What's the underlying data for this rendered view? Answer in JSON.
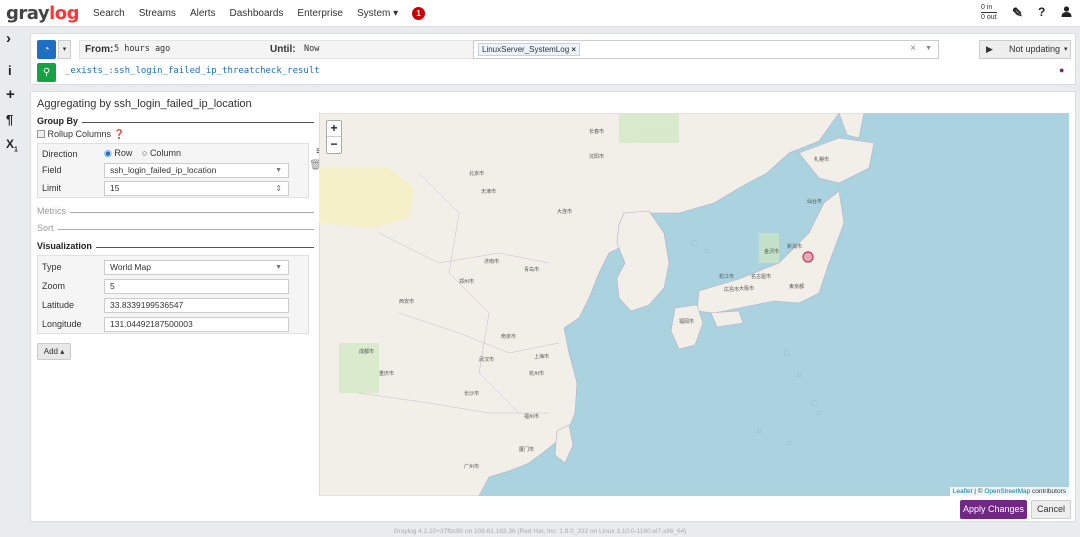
{
  "nav": {
    "logo_a": "gray",
    "logo_b": "log",
    "items": [
      "Search",
      "Streams",
      "Alerts",
      "Dashboards",
      "Enterprise",
      "System ▾"
    ],
    "notification_count": "1",
    "throughput_in": "0 in",
    "throughput_out": "0 out"
  },
  "query": {
    "from_label": "From:",
    "from_value": "5 hours ago",
    "until_label": "Until:",
    "until_value": "Now",
    "stream_chip": "LinuxServer_SystemLog",
    "update_label": "Not updating",
    "text": "_exists_:ssh_login_failed_ip_threatcheck_result"
  },
  "widget": {
    "title": "Aggregating by ssh_login_failed_ip_location",
    "group_by_label": "Group By",
    "rollup_label": "Rollup Columns",
    "direction_label": "Direction",
    "row_label": "Row",
    "column_label": "Column",
    "field_label": "Field",
    "field_value": "ssh_login_failed_ip_location",
    "limit_label": "Limit",
    "limit_value": "15",
    "metrics_label": "Metrics",
    "sort_label": "Sort",
    "visualization_label": "Visualization",
    "type_label": "Type",
    "type_value": "World Map",
    "zoom_label": "Zoom",
    "zoom_value": "5",
    "latitude_label": "Latitude",
    "latitude_value": "33.8339199536547",
    "longitude_label": "Longitude",
    "longitude_value": "131.04492187500003",
    "add_label": "Add ▴",
    "apply_label": "Apply Changes",
    "cancel_label": "Cancel"
  },
  "map": {
    "attribution_leaflet": "Leaflet",
    "attribution_sep": " | © ",
    "attribution_osm": "OpenStreetMap",
    "attribution_tail": " contributors",
    "land_color": "#f2efe9",
    "water_color": "#aad3df",
    "marker_color": "#c0395a",
    "cities": [
      "北京市",
      "天津市",
      "上海市",
      "南京市",
      "杭州市",
      "武汉市",
      "长沙市",
      "重庆市",
      "成都市",
      "西安市",
      "郑州市",
      "济南市",
      "青岛市",
      "沈阳市",
      "长春市",
      "大连市",
      "福州市",
      "厦门市",
      "广州市",
      "福岡市",
      "大阪市",
      "名古屋市",
      "東京都",
      "仙台市",
      "札幌市",
      "新潟市",
      "金沢市",
      "松江市",
      "広島市"
    ]
  },
  "footer": "Graylog 4.2.10+37fbc90 on 108.61.163.36 (Red Hat, Inc. 1.8.0_332 on Linux 3.10.0-1160.el7.x86_64)"
}
